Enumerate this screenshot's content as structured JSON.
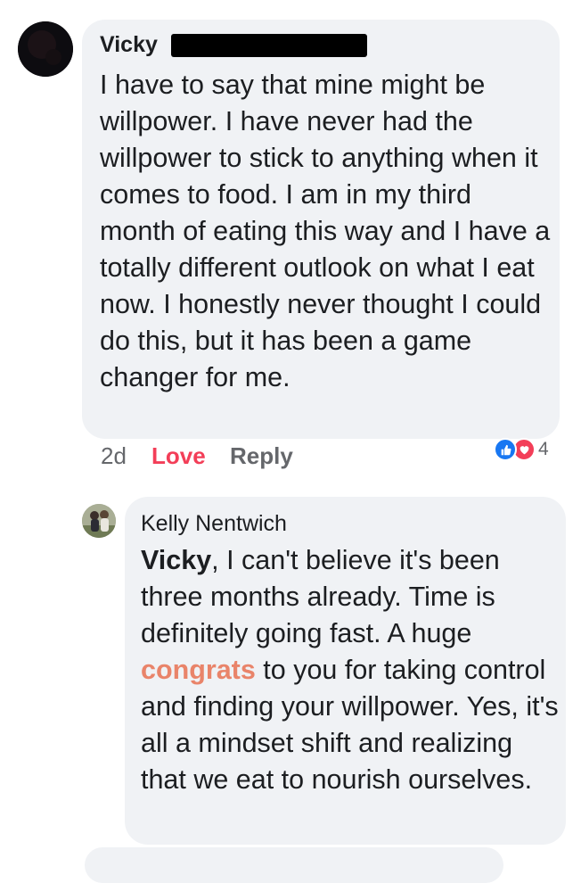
{
  "comments": [
    {
      "author": "Vicky",
      "text": "I have to say that mine might be willpower. I have never had the willpower to stick to anything when it comes to food. I am in my third month of eating this way and I have a totally different outlook on what I eat now. I honestly never thought I could do this, but it has been a game changer for me.",
      "timestamp": "2d",
      "reaction_label": "Love",
      "reply_label": "Reply",
      "reactions": {
        "icons": [
          "like-icon",
          "heart-icon"
        ],
        "count": "4"
      }
    },
    {
      "author": "Kelly Nentwich",
      "mention": "Vicky",
      "text_part1": ", I can't believe it's been three months already. Time is definitely going fast. A huge ",
      "highlight": "congrats",
      "text_part2": " to you for taking control and finding your willpower. Yes, it's all a mindset shift and realizing that we eat to nourish ourselves."
    }
  ],
  "colors": {
    "bubble": "#f0f2f5",
    "love": "#f33e58",
    "like": "#1877f2",
    "highlight": "#e9846a",
    "meta": "#65676b"
  }
}
